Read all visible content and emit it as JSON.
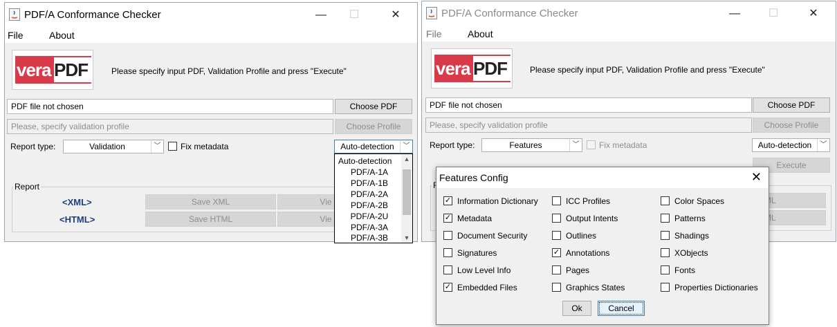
{
  "window1": {
    "title": "PDF/A Conformance Checker",
    "controls": {
      "minimize": "—",
      "maximize": "☐",
      "close": "✕"
    },
    "menu": {
      "file": "File",
      "about": "About"
    },
    "logo": {
      "part1": "vera",
      "part2": "PDF"
    },
    "instruction": "Please specify input PDF, Validation Profile and press \"Execute\"",
    "pdf_field": "PDF file not chosen",
    "choose_pdf": "Choose PDF",
    "profile_field": "Please, specify validation profile",
    "choose_profile": "Choose Profile",
    "report_type_label": "Report type:",
    "report_type_value": "Validation",
    "fix_metadata_label": "Fix metadata",
    "flavour_value": "Auto-detection",
    "dropdown_options": [
      "Auto-detection",
      "PDF/A-1A",
      "PDF/A-1B",
      "PDF/A-2A",
      "PDF/A-2B",
      "PDF/A-2U",
      "PDF/A-3A",
      "PDF/A-3B"
    ],
    "report_group_title": "Report",
    "xml_link": "<XML>",
    "html_link": "<HTML>",
    "save_xml": "Save XML",
    "save_html": "Save HTML",
    "view_xml_partial": "Vie",
    "view_html_partial": "Vie"
  },
  "window2": {
    "title": "PDF/A Conformance Checker",
    "controls": {
      "minimize": "—",
      "maximize": "☐",
      "close": "✕"
    },
    "menu": {
      "file": "File",
      "about": "About"
    },
    "logo": {
      "part1": "vera",
      "part2": "PDF"
    },
    "instruction": "Please specify input PDF, Validation Profile and press \"Execute\"",
    "pdf_field": "PDF file not chosen",
    "choose_pdf": "Choose PDF",
    "profile_field": "Please, specify validation profile",
    "choose_profile": "Choose Profile",
    "report_type_label": "Report type:",
    "report_type_value": "Features",
    "fix_metadata_label": "Fix metadata",
    "flavour_value": "Auto-detection",
    "execute": "Execute",
    "report_group_partial": "R",
    "xml_partial": "ML",
    "html_partial": "ML"
  },
  "features_dialog": {
    "title": "Features Config",
    "close": "✕",
    "items": [
      {
        "label": "Information Dictionary",
        "checked": true
      },
      {
        "label": "Metadata",
        "checked": true
      },
      {
        "label": "Document Security",
        "checked": false
      },
      {
        "label": "Signatures",
        "checked": false
      },
      {
        "label": "Low Level Info",
        "checked": false
      },
      {
        "label": "Embedded Files",
        "checked": true
      },
      {
        "label": "ICC Profiles",
        "checked": false
      },
      {
        "label": "Output Intents",
        "checked": false
      },
      {
        "label": "Outlines",
        "checked": false
      },
      {
        "label": "Annotations",
        "checked": true
      },
      {
        "label": "Pages",
        "checked": false
      },
      {
        "label": "Graphics States",
        "checked": false
      },
      {
        "label": "Color Spaces",
        "checked": false
      },
      {
        "label": "Patterns",
        "checked": false
      },
      {
        "label": "Shadings",
        "checked": false
      },
      {
        "label": "XObjects",
        "checked": false
      },
      {
        "label": "Fonts",
        "checked": false
      },
      {
        "label": "Properties Dictionaries",
        "checked": false
      }
    ],
    "ok": "Ok",
    "cancel": "Cancel"
  },
  "colors": {
    "logo_red": "#d83a4a",
    "link_blue": "#1c3e7c"
  }
}
